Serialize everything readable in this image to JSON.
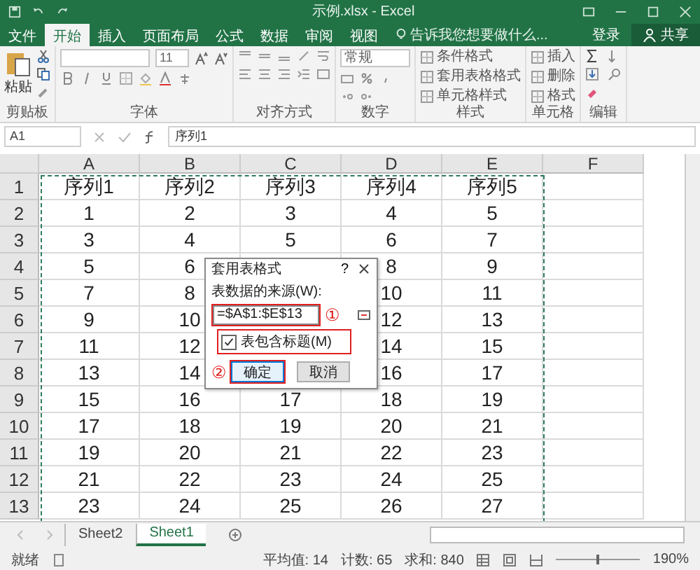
{
  "window": {
    "title": "示例.xlsx - Excel"
  },
  "ribbon_tabs": [
    {
      "label": "文件",
      "selected": false
    },
    {
      "label": "开始",
      "selected": true
    },
    {
      "label": "插入",
      "selected": false
    },
    {
      "label": "页面布局",
      "selected": false
    },
    {
      "label": "公式",
      "selected": false
    },
    {
      "label": "数据",
      "selected": false
    },
    {
      "label": "审阅",
      "selected": false
    },
    {
      "label": "视图",
      "selected": false
    }
  ],
  "tell_me": {
    "placeholder": "告诉我您想要做什么..."
  },
  "account": {
    "sign_in": "登录",
    "share": "共享"
  },
  "ribbon_groups": [
    {
      "label": "剪贴板",
      "kind": "clipboard",
      "items": [
        "粘贴"
      ]
    },
    {
      "label": "字体",
      "kind": "font",
      "font_size": "11"
    },
    {
      "label": "对齐方式",
      "kind": "alignment"
    },
    {
      "label": "数字",
      "kind": "number",
      "format": "常规"
    },
    {
      "label": "样式",
      "kind": "styles",
      "items": [
        "条件格式",
        "套用表格格式",
        "单元格样式"
      ]
    },
    {
      "label": "单元格",
      "kind": "cells",
      "items": [
        "插入",
        "删除",
        "格式"
      ]
    },
    {
      "label": "编辑",
      "kind": "editing"
    }
  ],
  "name_box": "A1",
  "formula": "序列1",
  "columns": [
    "A",
    "B",
    "C",
    "D",
    "E",
    "F"
  ],
  "rows": [
    {
      "number": "1",
      "cells": [
        "序列1",
        "序列2",
        "序列3",
        "序列4",
        "序列5"
      ]
    },
    {
      "number": "2",
      "cells": [
        "1",
        "2",
        "3",
        "4",
        "5"
      ]
    },
    {
      "number": "3",
      "cells": [
        "3",
        "4",
        "5",
        "6",
        "7"
      ]
    },
    {
      "number": "4",
      "cells": [
        "5",
        "6",
        null,
        "8",
        "9"
      ]
    },
    {
      "number": "5",
      "cells": [
        "7",
        "8",
        null,
        "10",
        "11"
      ]
    },
    {
      "number": "6",
      "cells": [
        "9",
        "10",
        null,
        "12",
        "13"
      ]
    },
    {
      "number": "7",
      "cells": [
        "11",
        "12",
        null,
        "14",
        "15"
      ]
    },
    {
      "number": "8",
      "cells": [
        "13",
        "14",
        null,
        "16",
        "17"
      ]
    },
    {
      "number": "9",
      "cells": [
        "15",
        "16",
        "17",
        "18",
        "19"
      ]
    },
    {
      "number": "10",
      "cells": [
        "17",
        "18",
        "19",
        "20",
        "21"
      ]
    },
    {
      "number": "11",
      "cells": [
        "19",
        "20",
        "21",
        "22",
        "23"
      ]
    },
    {
      "number": "12",
      "cells": [
        "21",
        "22",
        "23",
        "24",
        "25"
      ]
    },
    {
      "number": "13",
      "cells": [
        "23",
        "24",
        "25",
        "26",
        "27"
      ]
    }
  ],
  "dialog": {
    "title": "套用表格式",
    "help": "?",
    "source_label": "表数据的来源(W):",
    "source_value": "=$A$1:$E$13",
    "source_marker": "①",
    "has_headers_label": "表包含标题(M)",
    "has_headers": true,
    "ok_marker": "②",
    "ok": "确定",
    "cancel": "取消"
  },
  "sheet_tabs": [
    {
      "label": "Sheet2",
      "selected": false
    },
    {
      "label": "Sheet1",
      "selected": true
    }
  ],
  "status_bar": {
    "mode": "就绪",
    "average": "平均值: 14",
    "count": "计数: 65",
    "sum": "求和: 840",
    "zoom": "190%",
    "zoom_slider": {
      "level": 0.47
    }
  }
}
